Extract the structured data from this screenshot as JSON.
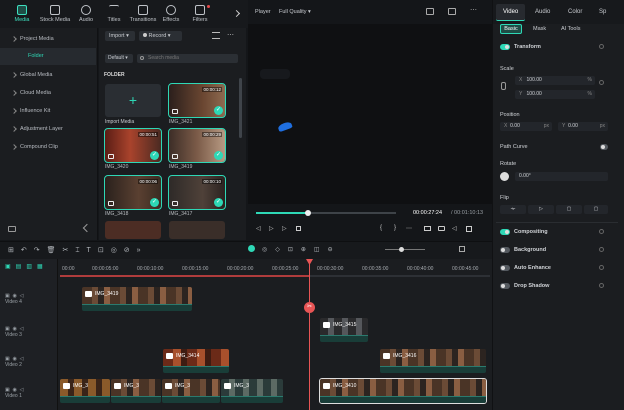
{
  "toolbar": {
    "items": [
      {
        "label": "Media",
        "icon": "media-icon"
      },
      {
        "label": "Stock Media",
        "icon": "stock-media-icon"
      },
      {
        "label": "Audio",
        "icon": "music-note-icon"
      },
      {
        "label": "Titles",
        "icon": "text-t-icon"
      },
      {
        "label": "Transitions",
        "icon": "transition-icon"
      },
      {
        "label": "Effects",
        "icon": "effects-icon"
      },
      {
        "label": "Filters",
        "icon": "filters-icon"
      }
    ]
  },
  "sidebar": {
    "items": [
      "Project Media",
      "Folder",
      "Global Media",
      "Cloud Media",
      "Influence Kit",
      "Adjustment Layer",
      "Compound Clip"
    ]
  },
  "media": {
    "import_label": "Import",
    "record_label": "Record",
    "sort_label": "Default",
    "search_placeholder": "Search media",
    "folder_title": "FOLDER",
    "import_media_label": "Import Media",
    "items": [
      {
        "name": "IMG_3421",
        "duration": "00:00:12"
      },
      {
        "name": "IMG_3420",
        "duration": "00:00:51"
      },
      {
        "name": "IMG_3419",
        "duration": "00:00:29"
      },
      {
        "name": "IMG_3418",
        "duration": "00:00:06"
      },
      {
        "name": "IMG_3417",
        "duration": "00:00:10"
      }
    ]
  },
  "player": {
    "label": "Player",
    "quality": "Full Quality",
    "current_time": "00:00:27:24",
    "total_time": "/ 00:01:10:13",
    "progress": 0.37
  },
  "properties": {
    "tabs": [
      "Video",
      "Audio",
      "Color",
      "Sp"
    ],
    "subtabs": [
      "Basic",
      "Mask",
      "AI Tools"
    ],
    "transform_label": "Transform",
    "scale_label": "Scale",
    "scale_x": "100.00",
    "scale_y": "100.00",
    "scale_unit": "%",
    "position_label": "Position",
    "pos_x_label": "X",
    "pos_x": "0.00",
    "pos_y_label": "Y",
    "pos_y": "0.00",
    "pos_unit": "px",
    "path_curve_label": "Path Curve",
    "rotate_label": "Rotate",
    "rotate_value": "0.00°",
    "flip_label": "Flip",
    "compositing_label": "Compositing",
    "background_label": "Background",
    "auto_enhance_label": "Auto Enhance",
    "drop_shadow_label": "Drop Shadow"
  },
  "timeline": {
    "ruler": [
      "00:00",
      "00:00:05:00",
      "00:00:10:00",
      "00:00:15:00",
      "00:00:20:00",
      "00:00:25:00",
      "00:00:30:00",
      "00:00:35:00",
      "00:00:40:00",
      "00:00:45:00"
    ],
    "tracks": [
      "Video 4",
      "Video 3",
      "Video 2",
      "Video 1"
    ],
    "clips": {
      "v4": "IMG_3419",
      "v3": "IMG_3415",
      "v2a": "IMG_3414",
      "v2b": "IMG_3416",
      "v1a": "IMG_3",
      "v1b": "IMG_3",
      "v1c": "IMG_3",
      "v1d": "IMG_3",
      "v1e": "IMG_3410"
    }
  },
  "colors": {
    "accent": "#2ed8b6",
    "playhead": "#e85555",
    "bg": "#141619"
  }
}
